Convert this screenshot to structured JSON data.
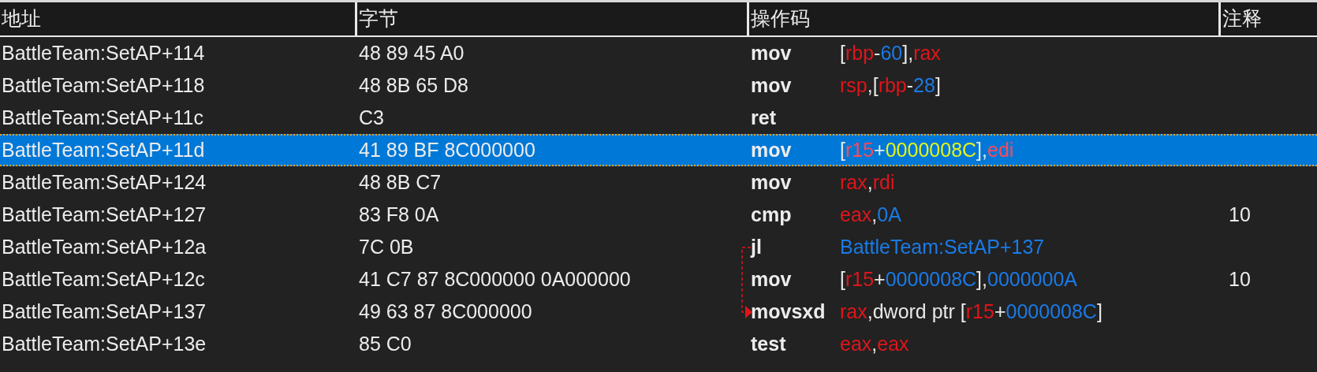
{
  "columns": [
    {
      "label": "地址"
    },
    {
      "label": "字节"
    },
    {
      "label": "操作码"
    },
    {
      "label": "注释"
    }
  ],
  "rows": [
    {
      "address": "BattleTeam:SetAP+114",
      "bytes": "48 89 45 A0",
      "mnemonic": "mov",
      "operands": [
        {
          "kind": "punct",
          "text": "["
        },
        {
          "kind": "register",
          "text": "rbp"
        },
        {
          "kind": "punct",
          "text": "-"
        },
        {
          "kind": "number",
          "text": "60"
        },
        {
          "kind": "punct",
          "text": "],"
        },
        {
          "kind": "register",
          "text": "rax"
        }
      ],
      "selected": false
    },
    {
      "address": "BattleTeam:SetAP+118",
      "bytes": "48 8B 65 D8",
      "mnemonic": "mov",
      "operands": [
        {
          "kind": "register",
          "text": "rsp"
        },
        {
          "kind": "punct",
          "text": ",["
        },
        {
          "kind": "register",
          "text": "rbp"
        },
        {
          "kind": "punct",
          "text": "-"
        },
        {
          "kind": "number",
          "text": "28"
        },
        {
          "kind": "punct",
          "text": "]"
        }
      ],
      "selected": false
    },
    {
      "address": "BattleTeam:SetAP+11c",
      "bytes": "C3",
      "mnemonic": "ret",
      "operands": [],
      "selected": false
    },
    {
      "address": "BattleTeam:SetAP+11d",
      "bytes": "41 89 BF 8C000000",
      "mnemonic": "mov",
      "operands": [
        {
          "kind": "punct",
          "text": "["
        },
        {
          "kind": "register",
          "text": "r15"
        },
        {
          "kind": "punct",
          "text": "+"
        },
        {
          "kind": "number",
          "text": "0000008C"
        },
        {
          "kind": "punct",
          "text": "],"
        },
        {
          "kind": "register",
          "text": "edi"
        }
      ],
      "selected": true
    },
    {
      "address": "BattleTeam:SetAP+124",
      "bytes": "48 8B C7",
      "mnemonic": "mov",
      "operands": [
        {
          "kind": "register",
          "text": "rax"
        },
        {
          "kind": "punct",
          "text": ","
        },
        {
          "kind": "register",
          "text": "rdi"
        }
      ],
      "selected": false
    },
    {
      "address": "BattleTeam:SetAP+127",
      "bytes": "83 F8 0A",
      "mnemonic": "cmp",
      "operands": [
        {
          "kind": "register",
          "text": "eax"
        },
        {
          "kind": "punct",
          "text": ","
        },
        {
          "kind": "number",
          "text": "0A"
        }
      ],
      "comment": "10",
      "selected": false
    },
    {
      "address": "BattleTeam:SetAP+12a",
      "bytes": "7C 0B",
      "mnemonic": "jl",
      "operands": [
        {
          "kind": "number",
          "text": "BattleTeam:SetAP+137"
        }
      ],
      "jump_source": true,
      "selected": false
    },
    {
      "address": "BattleTeam:SetAP+12c",
      "bytes": "41 C7 87 8C000000 0A000000",
      "mnemonic": "mov",
      "operands": [
        {
          "kind": "punct",
          "text": "["
        },
        {
          "kind": "register",
          "text": "r15"
        },
        {
          "kind": "punct",
          "text": "+"
        },
        {
          "kind": "number",
          "text": "0000008C"
        },
        {
          "kind": "punct",
          "text": "],"
        },
        {
          "kind": "number",
          "text": "0000000A"
        }
      ],
      "comment": "10",
      "selected": false
    },
    {
      "address": "BattleTeam:SetAP+137",
      "bytes": "49 63 87 8C000000",
      "mnemonic": "movsxd",
      "operands": [
        {
          "kind": "register",
          "text": "rax"
        },
        {
          "kind": "punct",
          "text": ",dword ptr ["
        },
        {
          "kind": "register",
          "text": "r15"
        },
        {
          "kind": "punct",
          "text": "+"
        },
        {
          "kind": "number",
          "text": "0000008C"
        },
        {
          "kind": "punct",
          "text": "]"
        }
      ],
      "jump_target": true,
      "selected": false
    },
    {
      "address": "BattleTeam:SetAP+13e",
      "bytes": "85 C0",
      "mnemonic": "test",
      "operands": [
        {
          "kind": "register",
          "text": "eax"
        },
        {
          "kind": "punct",
          "text": ","
        },
        {
          "kind": "register",
          "text": "eax"
        }
      ],
      "selected": false
    }
  ]
}
